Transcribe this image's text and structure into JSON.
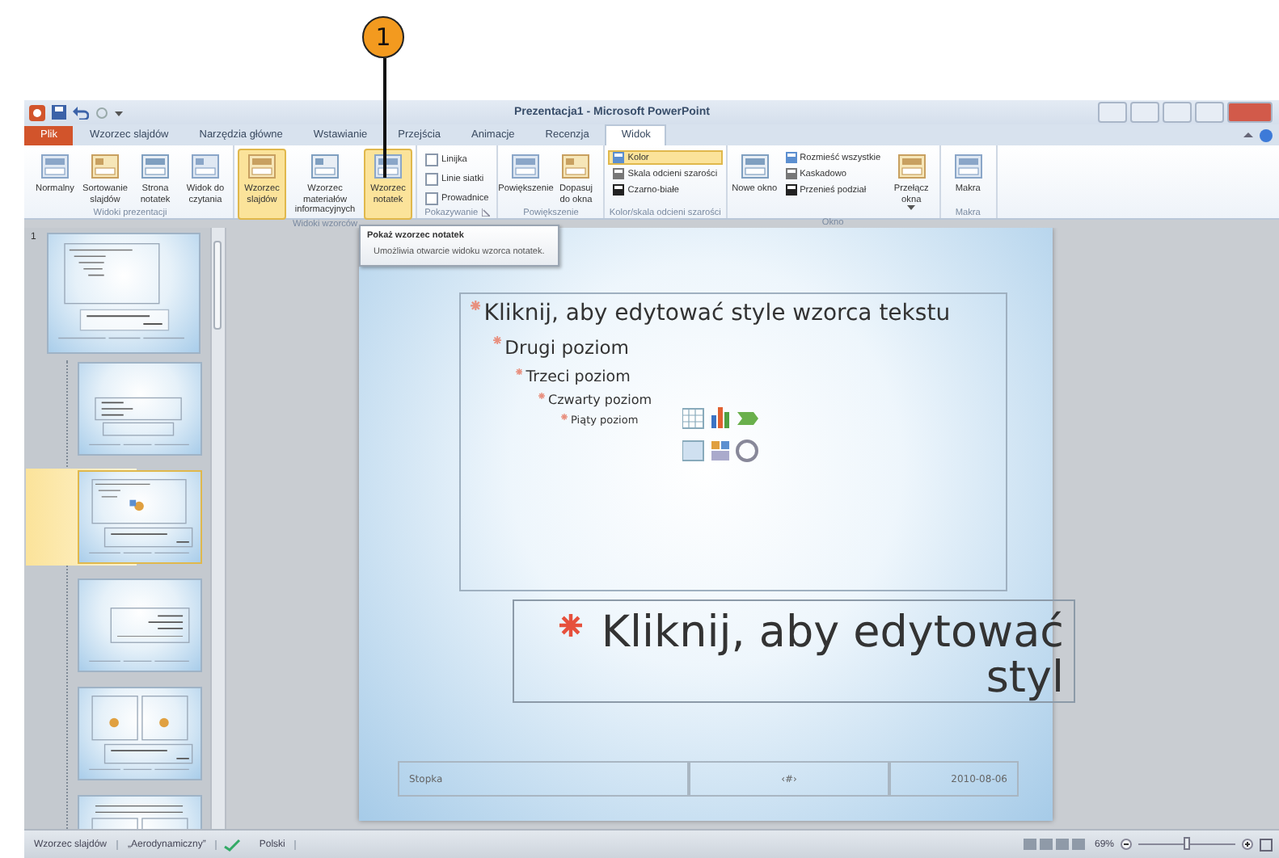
{
  "callout": {
    "number": "1"
  },
  "window": {
    "title": "Prezentacja1 - Microsoft PowerPoint"
  },
  "tabs": [
    {
      "label": "Plik",
      "kind": "file",
      "selected": false
    },
    {
      "label": "Wzorzec slajdów",
      "kind": "tab",
      "selected": false
    },
    {
      "label": "Narzędzia główne",
      "kind": "tab",
      "selected": false
    },
    {
      "label": "Wstawianie",
      "kind": "tab",
      "selected": false
    },
    {
      "label": "Przejścia",
      "kind": "tab",
      "selected": false
    },
    {
      "label": "Animacje",
      "kind": "tab",
      "selected": false
    },
    {
      "label": "Recenzja",
      "kind": "tab",
      "selected": false
    },
    {
      "label": "Widok",
      "kind": "tab",
      "selected": true
    }
  ],
  "ribbon": {
    "groups": [
      {
        "label": "Widoki prezentacji",
        "items": [
          {
            "kind": "large",
            "label": "Normalny",
            "selected": false
          },
          {
            "kind": "large",
            "label": "Sortowanie slajdów",
            "selected": false
          },
          {
            "kind": "large",
            "label": "Strona notatek",
            "selected": false
          },
          {
            "kind": "large",
            "label": "Widok do czytania",
            "selected": false
          }
        ]
      },
      {
        "label": "Widoki wzorców",
        "items": [
          {
            "kind": "large",
            "label": "Wzorzec slajdów",
            "selected": true
          },
          {
            "kind": "large",
            "label": "Wzorzec materiałów informacyjnych",
            "selected": false
          },
          {
            "kind": "large",
            "label": "Wzorzec notatek",
            "selected": true
          }
        ]
      },
      {
        "label": "Pokazywanie",
        "launcher": true,
        "items": [
          {
            "kind": "stack",
            "items": [
              {
                "kind": "check",
                "label": "Linijka",
                "checked": false
              },
              {
                "kind": "check",
                "label": "Linie siatki",
                "checked": false
              },
              {
                "kind": "check",
                "label": "Prowadnice",
                "checked": false
              }
            ]
          }
        ]
      },
      {
        "label": "Powiększenie",
        "items": [
          {
            "kind": "large",
            "label": "Powiększenie",
            "selected": false
          },
          {
            "kind": "large",
            "label": "Dopasuj do okna",
            "selected": false
          }
        ]
      },
      {
        "label": "Kolor/skala odcieni szarości",
        "items": [
          {
            "kind": "stack",
            "items": [
              {
                "kind": "small",
                "label": "Kolor",
                "selected": true
              },
              {
                "kind": "small",
                "label": "Skala odcieni szarości",
                "selected": false
              },
              {
                "kind": "small",
                "label": "Czarno-białe",
                "selected": false
              }
            ]
          }
        ]
      },
      {
        "label": "Okno",
        "items": [
          {
            "kind": "large",
            "label": "Nowe okno",
            "selected": false
          },
          {
            "kind": "stack",
            "items": [
              {
                "kind": "small",
                "label": "Rozmieść wszystkie",
                "selected": false
              },
              {
                "kind": "small",
                "label": "Kaskadowo",
                "selected": false
              },
              {
                "kind": "small",
                "label": "Przenieś podział",
                "selected": false
              }
            ]
          },
          {
            "kind": "large",
            "label": "Przełącz okna",
            "dropdown": true,
            "selected": false
          }
        ]
      },
      {
        "label": "Makra",
        "items": [
          {
            "kind": "large",
            "label": "Makra",
            "selected": false
          }
        ]
      }
    ]
  },
  "thumbnails": [
    {
      "number": "1",
      "kind": "master",
      "selected": false,
      "children": [
        {
          "kind": "title",
          "selected": false
        },
        {
          "kind": "content",
          "selected": true
        },
        {
          "kind": "section",
          "selected": false
        },
        {
          "kind": "two",
          "selected": false
        },
        {
          "kind": "comparison",
          "selected": false
        }
      ]
    }
  ],
  "tooltip": {
    "title": "Pokaż wzorzec notatek",
    "text": "Umożliwia otwarcie widoku wzorca notatek."
  },
  "slide": {
    "body": [
      {
        "text": "Kliknij, aby edytować style wzorca tekstu",
        "children": [
          {
            "text": "Drugi poziom",
            "children": [
              {
                "text": "Trzeci poziom",
                "children": [
                  {
                    "text": "Czwarty poziom",
                    "children": [
                      {
                        "text": "Piąty poziom"
                      }
                    ]
                  }
                ]
              }
            ]
          }
        ]
      }
    ],
    "title": "Kliknij, aby edytować styl",
    "footer": "Stopka",
    "number": "‹#›",
    "date": "2010-08-06"
  },
  "status_bar": {
    "items": [
      "Wzorzec slajdów",
      "„Aerodynamiczny”",
      "Polski"
    ],
    "zoom": "69%",
    "zoom_slider": {
      "level": 0.5
    }
  }
}
